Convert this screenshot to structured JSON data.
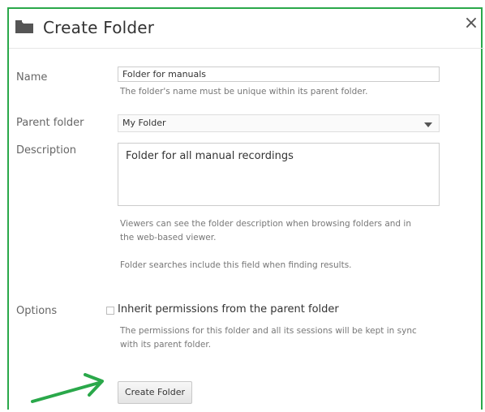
{
  "dialog": {
    "title": "Create Folder",
    "close_symbol": "×"
  },
  "form": {
    "name_label": "Name",
    "name_value": "Folder for manuals",
    "name_help": "The folder's name must be unique within its parent folder.",
    "parent_label": "Parent folder",
    "parent_value": "My Folder",
    "description_label": "Description",
    "description_value": "Folder for all manual recordings",
    "description_help_1": "Viewers can see the folder description when browsing folders and in",
    "description_help_2": "the web-based viewer.",
    "description_help_3": "Folder searches include this field when finding results.",
    "options_label": "Options",
    "inherit_label": "Inherit permissions from the parent folder",
    "inherit_checked": false,
    "inherit_help_1": "The permissions for this folder and all its sessions will be kept in sync",
    "inherit_help_2": "with its parent folder.",
    "submit_label": "Create Folder"
  },
  "colors": {
    "highlight": "#2aa84a"
  },
  "icons": [
    "folder-icon",
    "close-icon",
    "dropdown-arrow-icon",
    "pointer-arrow"
  ]
}
